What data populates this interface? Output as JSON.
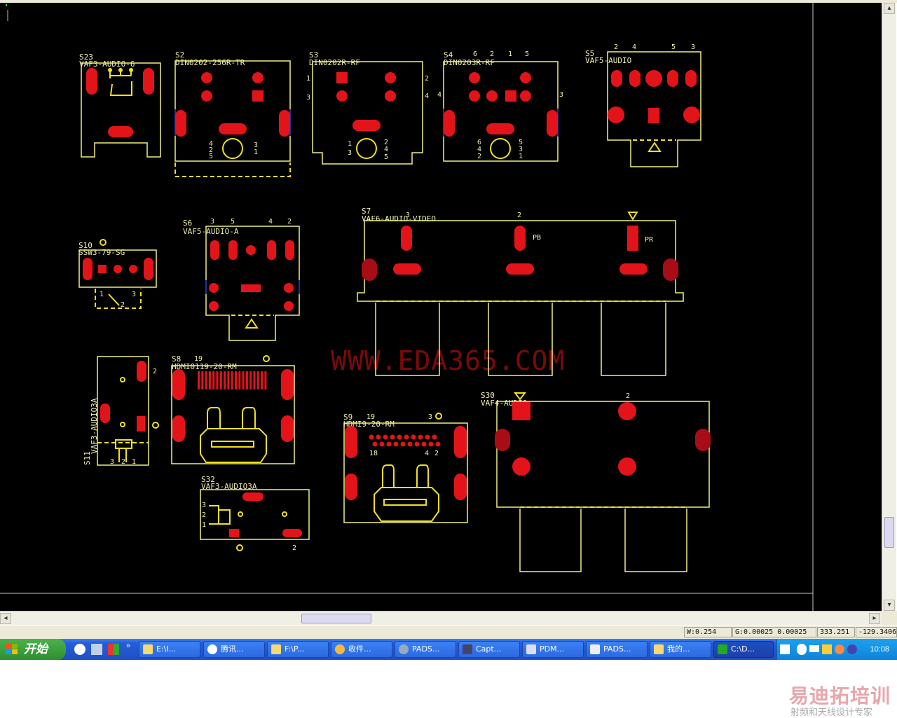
{
  "components": {
    "s23": {
      "ref": "S23",
      "part": "VAF3-AUDIO-6"
    },
    "s2": {
      "ref": "S2",
      "part": "DIN0202-256R-TR",
      "pins": [
        "4",
        "2",
        "5",
        "3",
        "1"
      ]
    },
    "s3": {
      "ref": "S3",
      "part": "DIN0202R-RF",
      "pins": [
        "1",
        "3",
        "2",
        "4",
        "1",
        "3",
        "2",
        "4",
        "5"
      ]
    },
    "s4": {
      "ref": "S4",
      "part": "DIN0203R-RF",
      "pins": [
        "6",
        "2",
        "1",
        "5",
        "4",
        "3",
        "6",
        "4",
        "2",
        "5",
        "3",
        "1"
      ]
    },
    "s5": {
      "ref": "S5",
      "part": "VAF5-AUDIO",
      "pins": [
        "2",
        "4",
        "5",
        "3"
      ]
    },
    "s10": {
      "ref": "S10",
      "part": "SSW3-79-SG",
      "pins": [
        "1",
        "3",
        "2"
      ]
    },
    "s6": {
      "ref": "S6",
      "part": "VAF5-AUDIO-A",
      "pins": [
        "3",
        "5",
        "4",
        "2"
      ]
    },
    "s7": {
      "ref": "S7",
      "part": "VAF6-AUDIO-VIDEO",
      "pins": [
        "3",
        "2"
      ],
      "labels": [
        "PB",
        "PR"
      ]
    },
    "s11": {
      "ref": "S11",
      "part": "VAF3-AUDIO3A",
      "pins": [
        "2",
        "3",
        "2",
        "1"
      ]
    },
    "s8": {
      "ref": "S8",
      "part": "HDMI0119-20-RM",
      "pins": [
        "19"
      ]
    },
    "s9": {
      "ref": "S9",
      "part": "HDMI9-20-RM",
      "pins": [
        "19",
        "3",
        "18",
        "4",
        "2"
      ]
    },
    "s30": {
      "ref": "S30",
      "part": "VAF4-AUDIO",
      "pins": [
        "2"
      ]
    },
    "s32": {
      "ref": "S32",
      "part": "VAF3-AUDIO3A",
      "pins": [
        "3",
        "2",
        "1",
        "2"
      ]
    }
  },
  "watermark": "WWW.EDA365.COM",
  "status": {
    "width": "W:0.254",
    "grid": "G:0.00025 0.00025",
    "x": "333.251",
    "y": "-129.3406"
  },
  "taskbar": {
    "start_label": "开始",
    "tasks": [
      "E:\\I...",
      "腾讯...",
      "F:\\P...",
      "收件...",
      "PADS...",
      "Capt...",
      "PDM...",
      "PADS...",
      "我的...",
      "C:\\D..."
    ],
    "clock": "10:08"
  },
  "footer": {
    "brand": "易迪拓培训",
    "tagline": "射频和天线设计专家"
  },
  "colors": {
    "background": "#000000",
    "pad": "#e2141a",
    "outline": "#f0f080",
    "silk": "#f0e020"
  }
}
